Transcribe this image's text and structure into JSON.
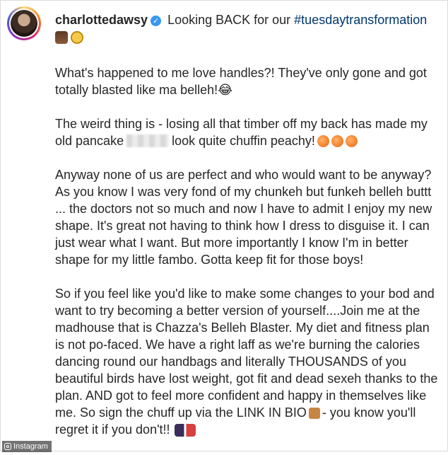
{
  "post": {
    "username": "charlottedawsy",
    "verified_mark": "✓",
    "intro_text": "Looking BACK for our",
    "hashtag": "#tuesdaytransformation"
  },
  "caption": {
    "p1": "What's happened to me love handles?! They've only gone and got totally blasted like ma belleh!😂",
    "p2_before": "The weird thing is - losing all that timber off my back has made my old pancake",
    "p2_after": "look quite chuffin peachy!",
    "p3": "Anyway none of us are perfect and who would want to be anyway? As you know I was very fond of my chunkeh but funkeh belleh buttt ... the doctors not so much and now I have to admit I enjoy my new shape. It's great not having to think how I dress to disguise it. I can just wear what I want. But more importantly I know I'm in better shape for my little fambo. Gotta keep fit for those boys!",
    "p4_before": "So if you feel like you'd like to make some changes to your bod and want to try becoming a better version of yourself....Join me at the madhouse that is Chazza's Belleh Blaster. My diet and fitness plan is not po-faced. We have a right laff as we're burning the calories dancing round our handbags and literally THOUSANDS of you beautiful birds have lost weight, got fit and dead sexeh thanks to the plan. AND got to feel more confident and happy in themselves like me. So sign the chuff up via the LINK IN BIO",
    "p4_after": "- you know you'll regret it if you don't!!"
  },
  "watermark": {
    "label": "Instagram"
  },
  "icons": {
    "avatar": "profile-photo",
    "verified": "verified-badge-icon",
    "peach": "peach-emoji-icon",
    "pointer": "pointing-hand-emoji-icon",
    "dancers": "dancers-emoji-icon"
  },
  "colors": {
    "verified": "#3897f0",
    "hashtag": "#00376b",
    "text": "#262626"
  }
}
